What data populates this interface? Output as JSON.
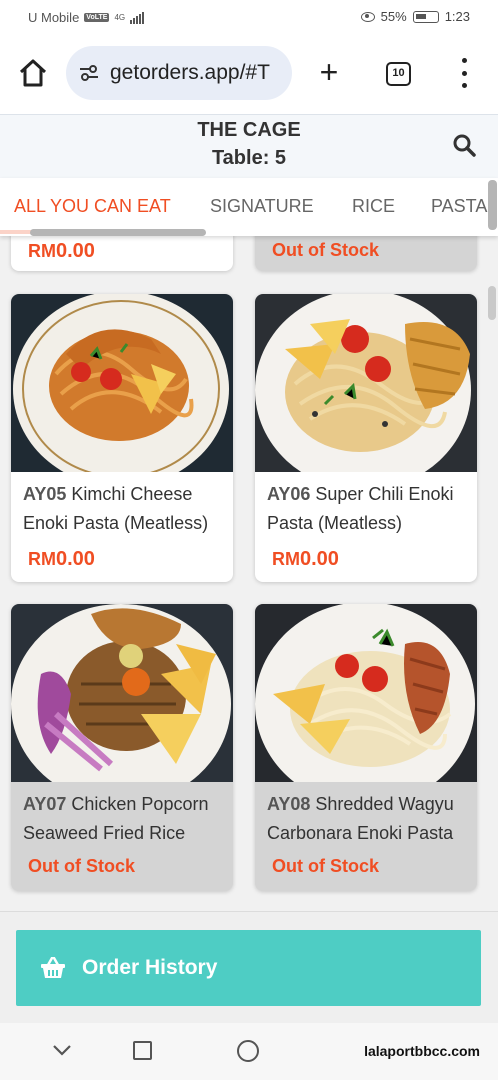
{
  "status_bar": {
    "carrier": "U Mobile",
    "volte": "VoLTE",
    "network": "4G",
    "battery": "55%",
    "time": "1:23"
  },
  "browser": {
    "url": "getorders.app/#T",
    "tab_count": "10"
  },
  "header": {
    "store_name": "THE CAGE",
    "table": "Table: 5"
  },
  "categories": [
    {
      "label": "ALL YOU CAN EAT",
      "active": true
    },
    {
      "label": "SIGNATURE",
      "active": false
    },
    {
      "label": "RICE",
      "active": false
    },
    {
      "label": "PASTA",
      "active": false
    }
  ],
  "partial_row": {
    "left_price_prefix": "RM",
    "left_price_value": "0.00",
    "right_status": "Out of Stock"
  },
  "items": [
    {
      "code": "AY05",
      "name": "Kimchi Cheese Enoki Pasta (Meatless)",
      "price_prefix": "RM",
      "price_value": "0.00",
      "status": ""
    },
    {
      "code": "AY06",
      "name": "Super Chili Enoki Pasta (Meatless)",
      "price_prefix": "RM",
      "price_value": "0.00",
      "status": ""
    },
    {
      "code": "AY07",
      "name": "Chicken Popcorn Seaweed Fried Rice",
      "price_prefix": "",
      "price_value": "",
      "status": "Out of Stock"
    },
    {
      "code": "AY08",
      "name": "Shredded Wagyu Carbonara Enoki Pasta",
      "price_prefix": "",
      "price_value": "",
      "status": "Out of Stock"
    }
  ],
  "order_history": {
    "label": "Order History"
  },
  "watermark": "lalaportbbcc.com",
  "colors": {
    "accent": "#f04e23",
    "order_button": "#4ecdc4",
    "out_of_stock_card": "#d4d4d4"
  }
}
